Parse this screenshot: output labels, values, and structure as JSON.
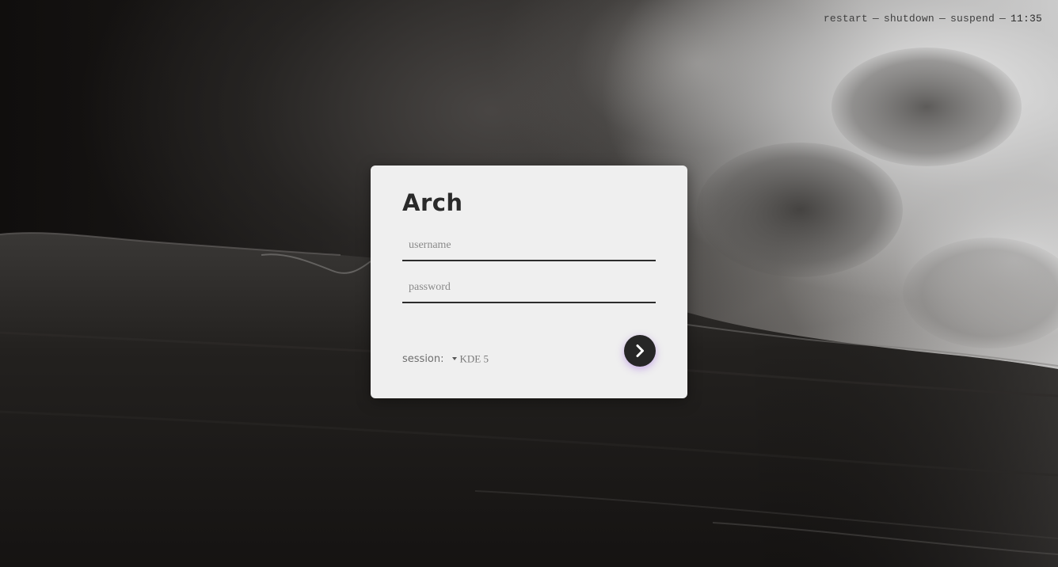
{
  "topbar": {
    "restart_label": "restart",
    "shutdown_label": "shutdown",
    "suspend_label": "suspend",
    "separator": "—",
    "clock": "11:35"
  },
  "login": {
    "host_title": "Arch",
    "username_placeholder": "username",
    "username_value": "",
    "password_placeholder": "password",
    "password_value": "",
    "session_label": "session:",
    "session_value": "KDE 5",
    "submit_icon": "chevron-right-icon"
  },
  "colors": {
    "card_background": "#efefef",
    "button_background": "#262626",
    "button_glow": "#965adc",
    "title_text": "#2a2a2a",
    "topbar_text": "#3f3f3f"
  }
}
